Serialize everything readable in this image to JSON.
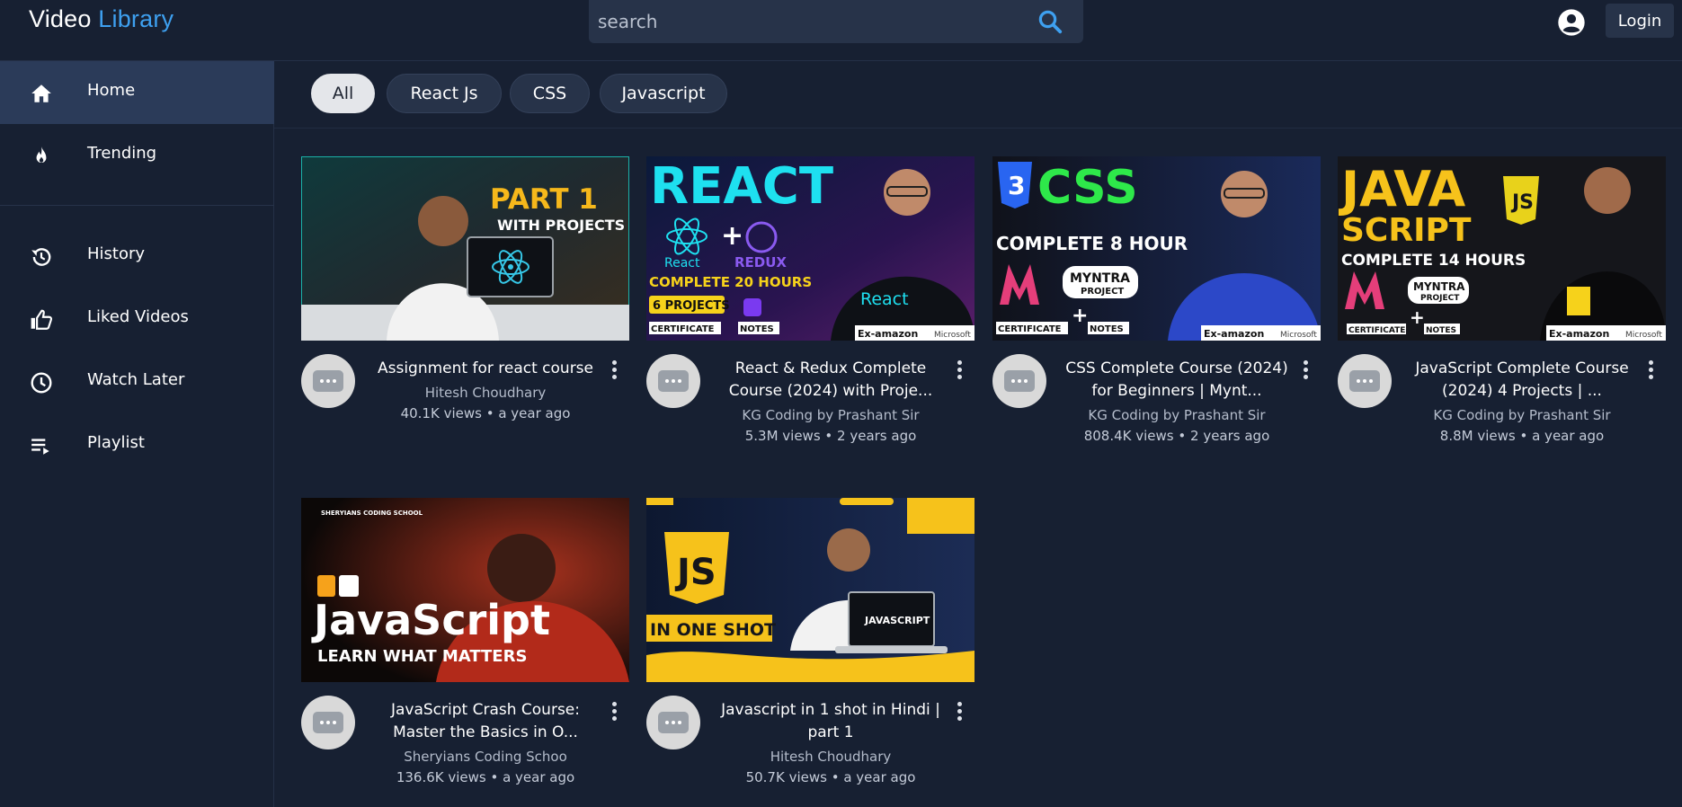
{
  "header": {
    "brand_part1": "Video",
    "brand_part2": "Library",
    "search_placeholder": "search",
    "search_icon": "search-icon",
    "account_icon": "account-circle-icon",
    "login_label": "Login"
  },
  "sidebar": {
    "items": [
      {
        "label": "Home",
        "icon": "home-icon",
        "active": true
      },
      {
        "label": "Trending",
        "icon": "fire-icon",
        "active": false
      },
      {
        "label": "History",
        "icon": "history-icon",
        "active": false
      },
      {
        "label": "Liked Videos",
        "icon": "thumbs-up-icon",
        "active": false
      },
      {
        "label": "Watch Later",
        "icon": "clock-icon",
        "active": false
      },
      {
        "label": "Playlist",
        "icon": "playlist-icon",
        "active": false
      }
    ]
  },
  "chips": [
    {
      "label": "All",
      "active": true
    },
    {
      "label": "React Js",
      "active": false
    },
    {
      "label": "CSS",
      "active": false
    },
    {
      "label": "Javascript",
      "active": false
    }
  ],
  "colors": {
    "background": "#172032",
    "accent": "#3ea0f0",
    "active_nav": "#2b3b59",
    "chip": "#273349"
  },
  "videos": [
    {
      "title": "Assignment for react course",
      "channel": "Hitesh Choudhary",
      "meta": "40.1K views • a year ago",
      "thumb_text": [
        "PART 1",
        "WITH PROJECTS"
      ]
    },
    {
      "title": "React & Redux Complete Course (2024) with Proje...",
      "channel": "KG Coding by Prashant Sir",
      "meta": "5.3M views • 2 years ago",
      "thumb_text": [
        "REACT",
        "React",
        "REDUX",
        "COMPLETE 20 HOURS",
        "6 PROJECTS",
        "CERTIFICATE",
        "NOTES",
        "Ex-amazon",
        "Microsoft"
      ]
    },
    {
      "title": "CSS Complete Course (2024) for Beginners | Mynt...",
      "channel": "KG Coding by Prashant Sir",
      "meta": "808.4K views • 2 years ago",
      "thumb_text": [
        "CSS",
        "COMPLETE 8 HOUR",
        "MYNTRA",
        "PROJECT",
        "CERTIFICATE",
        "NOTES",
        "Ex-amazon",
        "Microsoft"
      ]
    },
    {
      "title": "JavaScript Complete Course (2024) 4 Projects | ...",
      "channel": "KG Coding by Prashant Sir",
      "meta": "8.8M views • a year ago",
      "thumb_text": [
        "JAVA",
        "SCRIPT",
        "COMPLETE 14 HOURS",
        "MYNTRA",
        "PROJECT",
        "CERTIFICATE",
        "NOTES",
        "Ex-amazon",
        "Microsoft"
      ]
    },
    {
      "title": "JavaScript Crash Course: Master the Basics in O...",
      "channel": "Sheryians Coding Schoo",
      "meta": "136.6K views • a year ago",
      "thumb_text": [
        "SHERYIANS CODING SCHOOL",
        "JavaScript",
        "LEARN WHAT MATTERS"
      ]
    },
    {
      "title": "Javascript in 1 shot in Hindi | part 1",
      "channel": "Hitesh Choudhary",
      "meta": "50.7K views • a year ago",
      "thumb_text": [
        "JS",
        "IN ONE SHOT",
        "JAVASCRIPT"
      ]
    }
  ]
}
